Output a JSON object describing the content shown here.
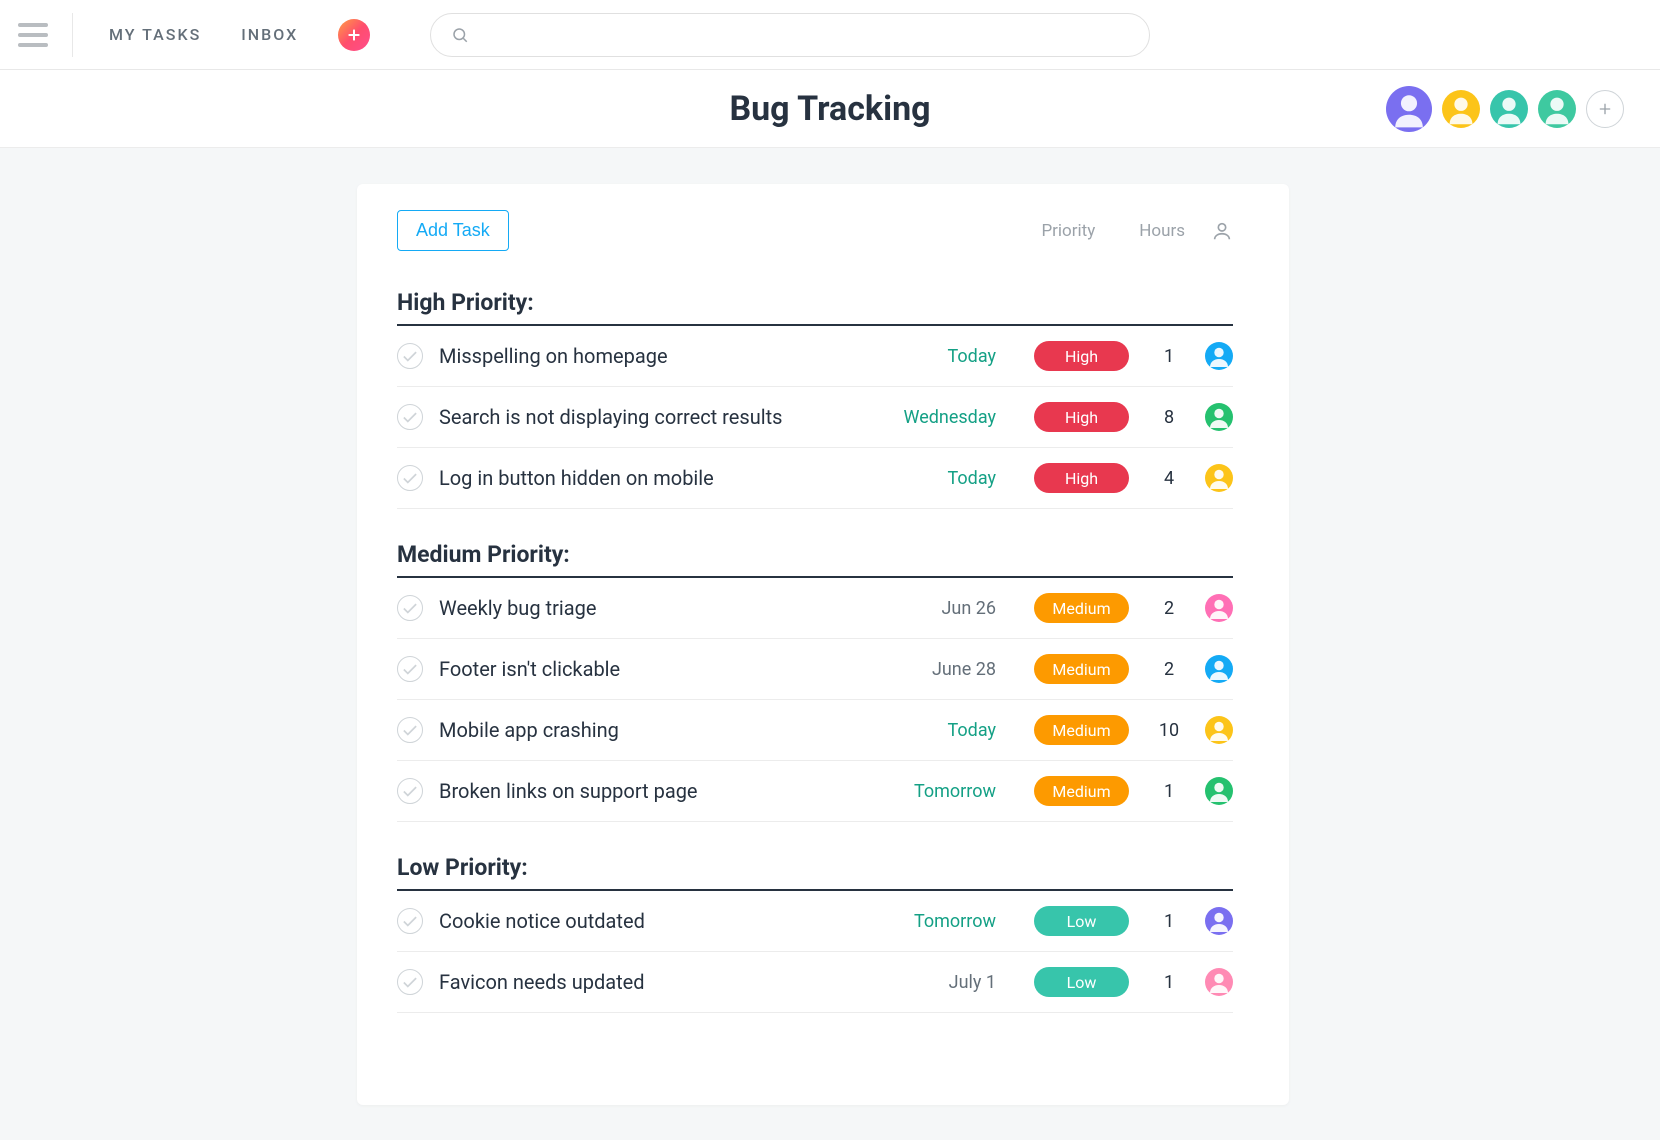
{
  "topnav": {
    "my_tasks": "MY TASKS",
    "inbox": "INBOX"
  },
  "search": {
    "placeholder": ""
  },
  "page": {
    "title": "Bug Tracking"
  },
  "header_avatars": [
    {
      "bg": "#7a6ff0"
    },
    {
      "bg": "#fcc419"
    },
    {
      "bg": "#37c5ab"
    },
    {
      "bg": "#3ec9a0"
    }
  ],
  "card": {
    "add_task_label": "Add Task",
    "columns": {
      "priority": "Priority",
      "hours": "Hours"
    }
  },
  "priority_labels": {
    "high": "High",
    "medium": "Medium",
    "low": "Low"
  },
  "sections": [
    {
      "title": "High Priority:",
      "tasks": [
        {
          "title": "Misspelling on homepage",
          "date": "Today",
          "date_style": "teal",
          "priority": "high",
          "hours": "1",
          "assignee_bg": "#14aaf5"
        },
        {
          "title": "Search is not displaying correct results",
          "date": "Wednesday",
          "date_style": "teal",
          "priority": "high",
          "hours": "8",
          "assignee_bg": "#25c16f"
        },
        {
          "title": "Log in button hidden on mobile",
          "date": "Today",
          "date_style": "teal",
          "priority": "high",
          "hours": "4",
          "assignee_bg": "#fcc419"
        }
      ]
    },
    {
      "title": "Medium Priority:",
      "tasks": [
        {
          "title": "Weekly bug triage",
          "date": "Jun 26",
          "date_style": "gray",
          "priority": "medium",
          "hours": "2",
          "assignee_bg": "#ff6fb5"
        },
        {
          "title": "Footer isn't clickable",
          "date": "June 28",
          "date_style": "gray",
          "priority": "medium",
          "hours": "2",
          "assignee_bg": "#14aaf5"
        },
        {
          "title": "Mobile app crashing",
          "date": "Today",
          "date_style": "teal",
          "priority": "medium",
          "hours": "10",
          "assignee_bg": "#fcc419"
        },
        {
          "title": "Broken links on support page",
          "date": "Tomorrow",
          "date_style": "teal",
          "priority": "medium",
          "hours": "1",
          "assignee_bg": "#25c16f"
        }
      ]
    },
    {
      "title": "Low Priority:",
      "tasks": [
        {
          "title": "Cookie notice outdated",
          "date": "Tomorrow",
          "date_style": "teal",
          "priority": "low",
          "hours": "1",
          "assignee_bg": "#7a6ff0"
        },
        {
          "title": "Favicon needs updated",
          "date": "July 1",
          "date_style": "gray",
          "priority": "low",
          "hours": "1",
          "assignee_bg": "#ff8ab4"
        }
      ]
    }
  ]
}
